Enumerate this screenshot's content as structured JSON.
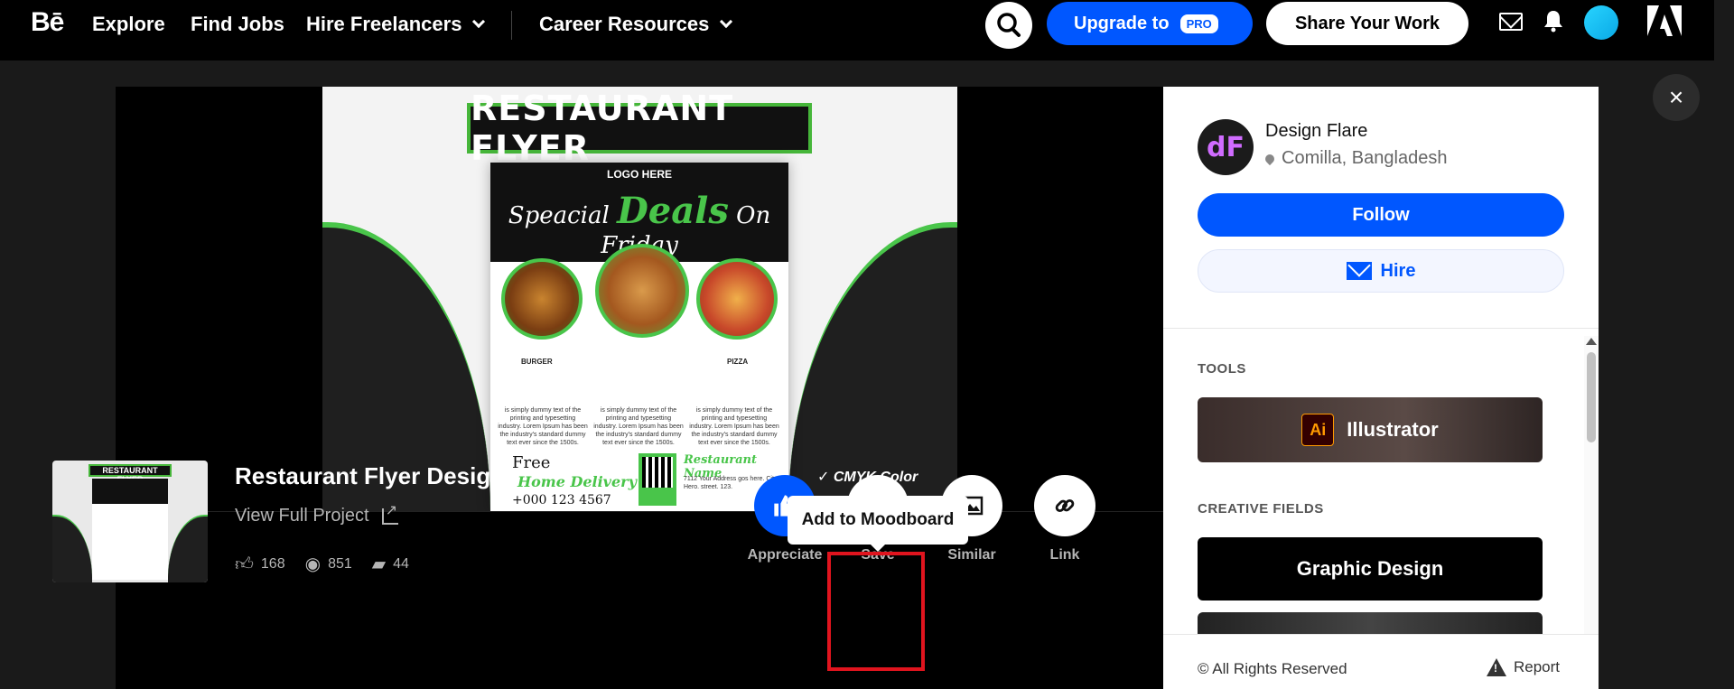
{
  "nav": {
    "logo": "Bē",
    "explore": "Explore",
    "find_jobs": "Find Jobs",
    "hire_freelancers": "Hire Freelancers",
    "career_resources": "Career Resources",
    "upgrade": "Upgrade to",
    "pro": "PRO",
    "share": "Share Your Work"
  },
  "close_label": "×",
  "flyer": {
    "banner": "RESTAURANT FLYER",
    "logo": "LOGO HERE",
    "headline_a": "Speacial",
    "headline_b": "Deals",
    "headline_c": "On Friday",
    "burger": "BURGER",
    "pizza": "PIZZA",
    "free": "Free",
    "home_delivery": "Home Delivery",
    "phone": "+000 123 4567",
    "restaurant_name": "Restaurant Name",
    "address": "7112 Your Address gos here. City Hero. street. 123.",
    "cmyk": "CMYK Color",
    "body_text": "is simply dummy text of the printing and typesetting industry. Lorem Ipsum has been the industry's standard dummy text ever since the 1500s."
  },
  "project": {
    "title": "Restaurant Flyer Design.",
    "view_full": "View Full Project",
    "likes": "168",
    "views": "851",
    "comments": "44"
  },
  "actions": {
    "appreciate": "Appreciate",
    "save": "Save",
    "similar": "Similar",
    "link": "Link",
    "tooltip": "Add to Moodboard"
  },
  "owner": {
    "initials": "dF",
    "name": "Design Flare",
    "location": "Comilla, Bangladesh",
    "follow": "Follow",
    "hire": "Hire"
  },
  "sections": {
    "tools": "TOOLS",
    "tool_name": "Illustrator",
    "tool_badge": "Ai",
    "creative_fields": "CREATIVE FIELDS",
    "field": "Graphic Design"
  },
  "footer": {
    "copyright": "© All Rights Reserved",
    "report": "Report"
  },
  "colors": {
    "accent": "#0057ff",
    "flyer_green": "#49c54a",
    "highlight": "#e0141e"
  }
}
